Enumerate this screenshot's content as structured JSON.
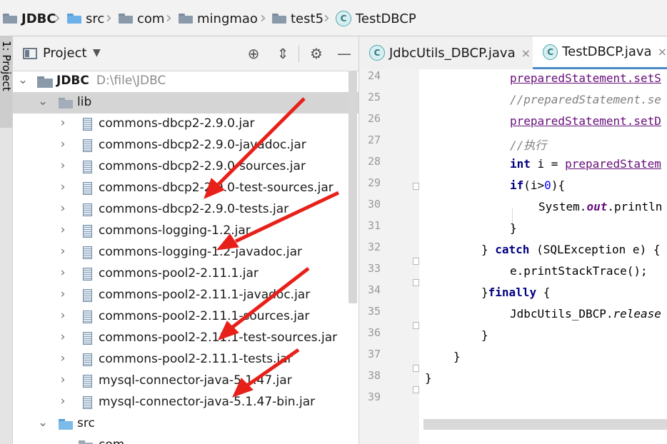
{
  "breadcrumb": {
    "items": [
      "JDBC",
      "src",
      "com",
      "mingmao",
      "test5",
      "TestDBCP"
    ],
    "class_badge": "C"
  },
  "left_stripe": {
    "tab_label": "1: Project"
  },
  "project_panel": {
    "title": "Project",
    "dropdown_icon": "caret-down-icon",
    "header_icons": [
      "locate-icon",
      "collapse-all-icon",
      "gear-icon",
      "minimize-icon"
    ],
    "root": {
      "name": "JDBC",
      "path": "D:\\file\\JDBC"
    },
    "lib_folder": "lib",
    "jars": [
      "commons-dbcp2-2.9.0.jar",
      "commons-dbcp2-2.9.0-javadoc.jar",
      "commons-dbcp2-2.9.0-sources.jar",
      "commons-dbcp2-2.9.0-test-sources.jar",
      "commons-dbcp2-2.9.0-tests.jar",
      "commons-logging-1.2.jar",
      "commons-logging-1.2-javadoc.jar",
      "commons-pool2-2.11.1.jar",
      "commons-pool2-2.11.1-javadoc.jar",
      "commons-pool2-2.11.1-sources.jar",
      "commons-pool2-2.11.1-test-sources.jar",
      "commons-pool2-2.11.1-tests.jar",
      "mysql-connector-java-5.1.47.jar",
      "mysql-connector-java-5.1.47-bin.jar"
    ],
    "src_folder": "src",
    "partial_item": "com"
  },
  "editor": {
    "tabs": [
      {
        "label": "JdbcUtils_DBCP.java",
        "active": false,
        "badge": "C"
      },
      {
        "label": "TestDBCP.java",
        "active": true,
        "badge": "C"
      }
    ],
    "close_glyph": "×",
    "line_numbers": [
      "24",
      "25",
      "26",
      "27",
      "28",
      "29",
      "30",
      "31",
      "32",
      "33",
      "34",
      "35",
      "36",
      "37",
      "38",
      "39"
    ],
    "code": {
      "l24": "preparedStatement.setS",
      "l25": "//preparedStatement.se",
      "l26": "preparedStatement.setD",
      "l27": "//执行",
      "l28_kw": "int",
      "l28_a": " i = ",
      "l28_var": "preparedStatem",
      "l29_kw": "if",
      "l29_a": "(i>",
      "l29_num": "0",
      "l29_b": "){",
      "l30_a": "System.",
      "l30_fld": "out",
      "l30_b": ".println",
      "l31": "}",
      "l32_a": "} ",
      "l32_kw": "catch",
      "l32_b": " (SQLException e) {",
      "l33": "e.printStackTrace();",
      "l34_a": "}",
      "l34_kw": "finally",
      "l34_b": " {",
      "l35_a": "JdbcUtils_DBCP.",
      "l35_st": "release",
      "l36": "}",
      "l37": "}",
      "l38": "}"
    }
  },
  "colors": {
    "annotation_arrow": "#e8201a",
    "keyword": "#000080",
    "field": "#660e7a",
    "comment": "#808080",
    "number": "#0000ff"
  }
}
